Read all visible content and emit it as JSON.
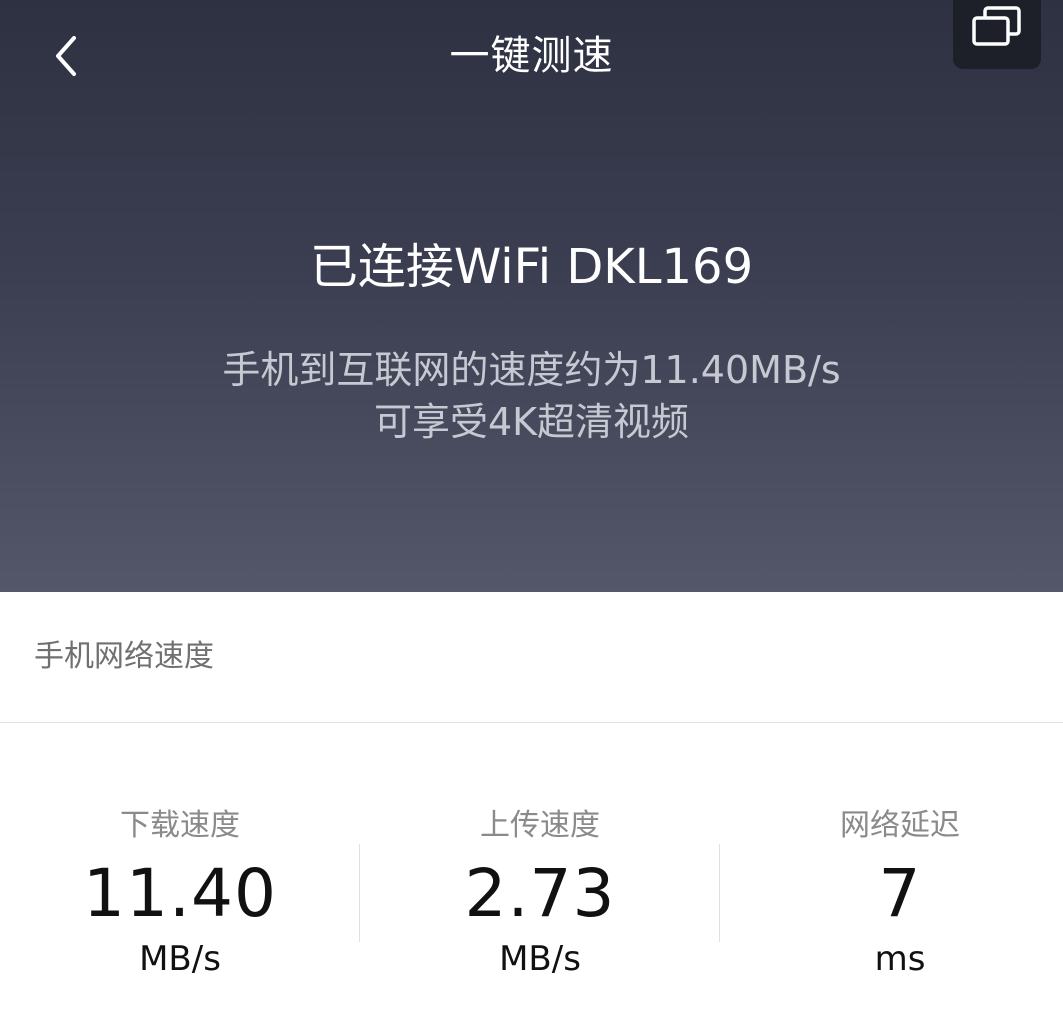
{
  "nav": {
    "title": "一键测速",
    "back_icon": "chevron-left-icon",
    "window_icon": "windows-overlap-icon"
  },
  "hero": {
    "wifi_title": "已连接WiFi DKL169",
    "speed_line": "手机到互联网的速度约为11.40MB/s",
    "quality_line": "可享受4K超清视频"
  },
  "section": {
    "title": "手机网络速度"
  },
  "stats": [
    {
      "label": "下载速度",
      "value": "11.40",
      "unit": "MB/s"
    },
    {
      "label": "上传速度",
      "value": "2.73",
      "unit": "MB/s"
    },
    {
      "label": "网络延迟",
      "value": "7",
      "unit": "ms"
    }
  ],
  "colors": {
    "hero_top": "#2e3141",
    "hero_bottom": "#535769",
    "text_primary": "#111111",
    "text_secondary": "#8a8a8a"
  }
}
